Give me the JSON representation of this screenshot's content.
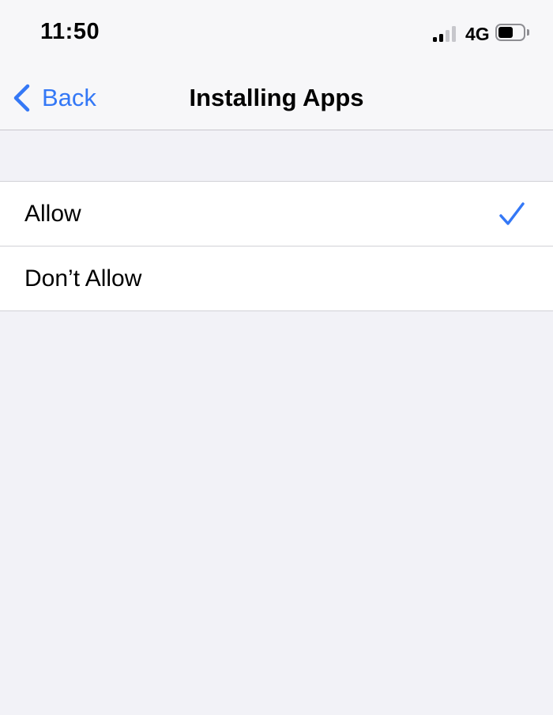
{
  "status_bar": {
    "time": "11:50",
    "network": "4G",
    "signal_bars_active": 2,
    "signal_bars_total": 4,
    "battery_level": 0.6,
    "icons": [
      "cellular-signal-icon",
      "battery-icon"
    ]
  },
  "nav": {
    "back_label": "Back",
    "title": "Installing Apps",
    "icons": [
      "chevron-left-icon"
    ]
  },
  "options": [
    {
      "label": "Allow",
      "selected": true
    },
    {
      "label": "Don’t Allow",
      "selected": false
    }
  ],
  "colors": {
    "accent": "#3478f6",
    "background": "#f2f2f7",
    "separator": "#d1d1d6"
  }
}
